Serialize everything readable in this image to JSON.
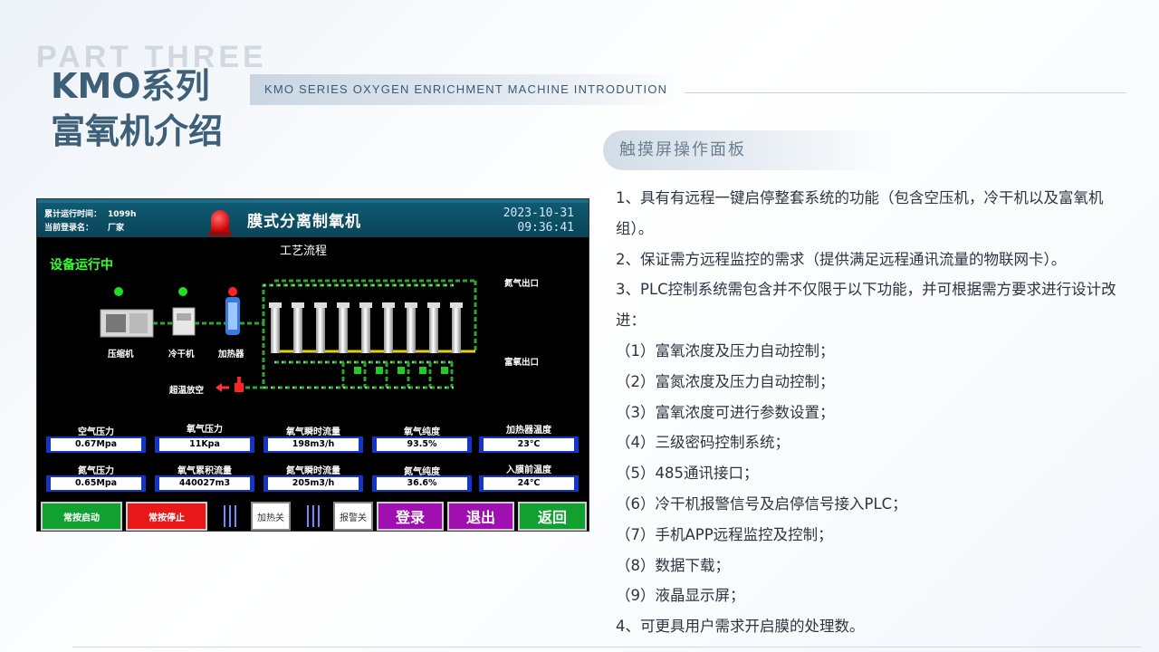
{
  "header": {
    "ghost_text": "PART THREE",
    "title_line1": "KMO系列",
    "title_line2": "富氧机介绍",
    "subtitle": "KMO SERIES OXYGEN ENRICHMENT MACHINE INTRODUTION"
  },
  "section": {
    "title": "触摸屏操作面板"
  },
  "features": [
    "1、具有有远程一键启停整套系统的功能（包含空压机，冷干机以及富氧机组）。",
    "2、保证需方远程监控的需求（提供满足远程通讯流量的物联网卡）。",
    "3、PLC控制系统需包含并不仅限于以下功能，并可根据需方要求进行设计改进：",
    "（1）富氧浓度及压力自动控制；",
    "（2）富氮浓度及压力自动控制；",
    "（3）富氧浓度可进行参数设置；",
    "（4）三级密码控制系统；",
    "（5）485通讯接口；",
    "（6）冷干机报警信号及启停信号接入PLC；",
    "（7）手机APP远程监控及控制；",
    "（8）数据下载；",
    "（9）液晶显示屏；",
    "4、可更具用户需求开启膜的处理数。"
  ],
  "hmi": {
    "run_time_label": "累计运行时间：",
    "run_time_value": "1099h",
    "login_label": "当前登录名：",
    "login_value": "厂家",
    "title": "膜式分离制氧机",
    "date": "2023-10-31",
    "time": "09:36:41",
    "process_title": "工艺流程",
    "status": "设备运行中",
    "equipment": {
      "compressor": "压缩机",
      "dryer": "冷干机",
      "heater": "加热器",
      "overtemp_vent": "超温放空",
      "nitrogen_outlet": "氮气出口",
      "oxygen_outlet": "富氧出口"
    },
    "status_colors": {
      "compressor": "#22dd22",
      "dryer": "#22dd22",
      "heater": "#ff2222"
    },
    "meters_row1": [
      {
        "label": "空气压力",
        "value": "0.67Mpa"
      },
      {
        "label": "氧气压力",
        "value": "11Kpa"
      },
      {
        "label": "氧气瞬时流量",
        "value": "198m3/h"
      },
      {
        "label": "氧气纯度",
        "value": "93.5%"
      },
      {
        "label": "加热器温度",
        "value": "23℃"
      }
    ],
    "meters_row2": [
      {
        "label": "氮气压力",
        "value": "0.65Mpa"
      },
      {
        "label": "氧气累积流量",
        "value": "440027m3"
      },
      {
        "label": "氮气瞬时流量",
        "value": "205m3/h"
      },
      {
        "label": "氮气纯度",
        "value": "36.6%"
      },
      {
        "label": "入膜前温度",
        "value": "24℃"
      }
    ],
    "buttons": {
      "start": "常按启动",
      "stop": "常按停止",
      "heater_off": "加热关",
      "alarm_off": "报警关",
      "login": "登录",
      "logout": "退出",
      "back": "返回"
    }
  }
}
